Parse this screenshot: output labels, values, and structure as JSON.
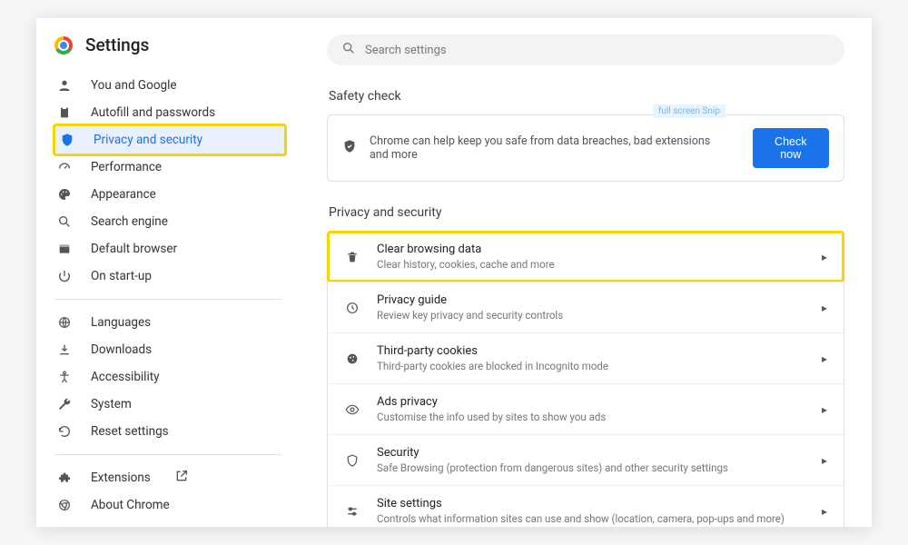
{
  "header": {
    "title": "Settings"
  },
  "search": {
    "placeholder": "Search settings"
  },
  "sidebar": {
    "items": [
      {
        "label": "You and Google"
      },
      {
        "label": "Autofill and passwords"
      },
      {
        "label": "Privacy and security"
      },
      {
        "label": "Performance"
      },
      {
        "label": "Appearance"
      },
      {
        "label": "Search engine"
      },
      {
        "label": "Default browser"
      },
      {
        "label": "On start-up"
      }
    ],
    "secondary": [
      {
        "label": "Languages"
      },
      {
        "label": "Downloads"
      },
      {
        "label": "Accessibility"
      },
      {
        "label": "System"
      },
      {
        "label": "Reset settings"
      }
    ],
    "footer": [
      {
        "label": "Extensions"
      },
      {
        "label": "About Chrome"
      }
    ]
  },
  "safety": {
    "section_title": "Safety check",
    "text": "Chrome can help keep you safe from data breaches, bad extensions and more",
    "button": "Check now",
    "badge": "full screen Snip"
  },
  "privacy": {
    "section_title": "Privacy and security",
    "rows": [
      {
        "title": "Clear browsing data",
        "sub": "Clear history, cookies, cache and more"
      },
      {
        "title": "Privacy guide",
        "sub": "Review key privacy and security controls"
      },
      {
        "title": "Third-party cookies",
        "sub": "Third-party cookies are blocked in Incognito mode"
      },
      {
        "title": "Ads privacy",
        "sub": "Customise the info used by sites to show you ads"
      },
      {
        "title": "Security",
        "sub": "Safe Browsing (protection from dangerous sites) and other security settings"
      },
      {
        "title": "Site settings",
        "sub": "Controls what information sites can use and show (location, camera, pop-ups and more)"
      }
    ]
  }
}
